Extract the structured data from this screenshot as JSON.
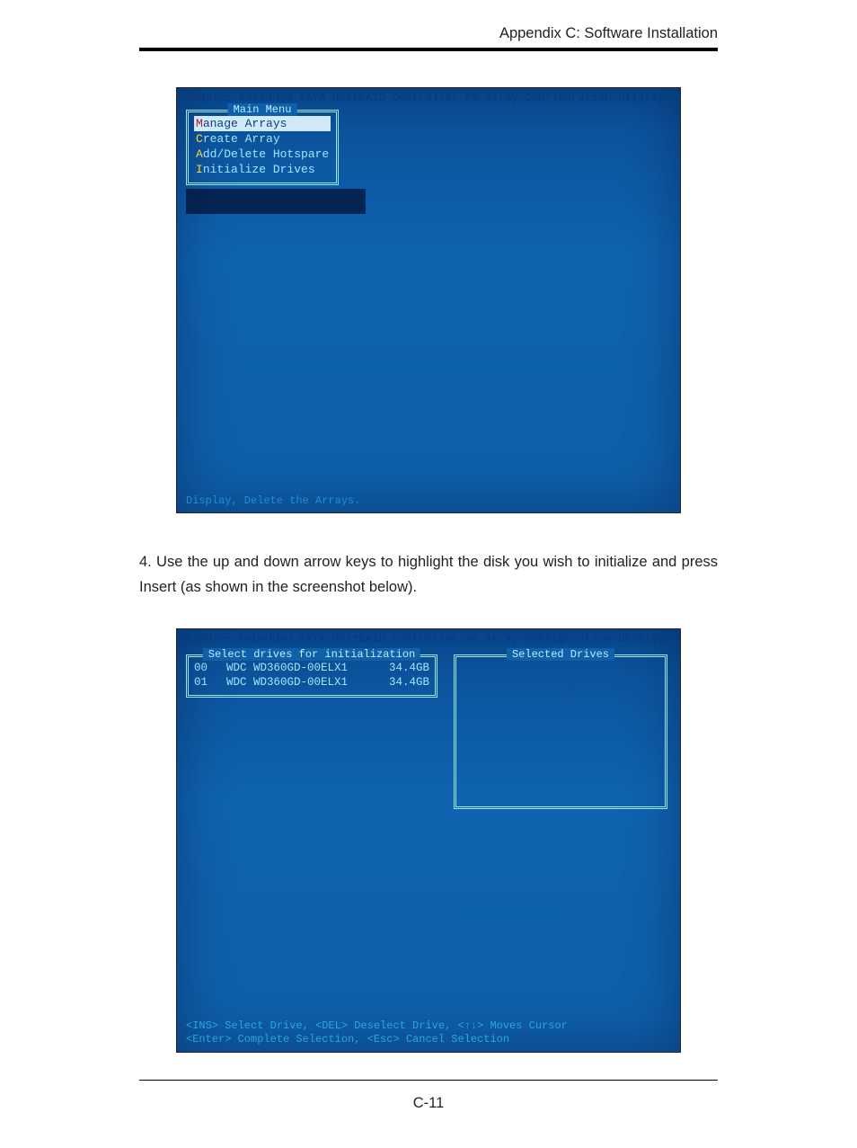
{
  "header": {
    "running": "Appendix C: Software Installation"
  },
  "footer": {
    "page": "C-11"
  },
  "paragraph": "4. Use the up and down arrow keys to highlight the disk you wish to initialize and press Insert (as shown in the screenshot below).",
  "screenshot1": {
    "title": "Adaptec Embedded SATA HostRAID Controller #0 Array Configuration Utility",
    "menu_title": "Main Menu",
    "items": [
      {
        "hotkey": "M",
        "rest": "anage Arrays",
        "selected": true
      },
      {
        "hotkey": "C",
        "rest": "reate Array",
        "selected": false
      },
      {
        "hotkey": "A",
        "rest": "dd/Delete Hotspare",
        "selected": false
      },
      {
        "hotkey": "I",
        "rest": "nitialize Drives",
        "selected": false
      }
    ],
    "footer": "Display, Delete the Arrays."
  },
  "screenshot2": {
    "title": "Adaptec Embedded SATA HostRAID Controller #0 Array Configuration Utility",
    "left_title": "Select drives for initialization",
    "right_title": "Selected Drives",
    "drives": [
      {
        "id": "00",
        "model": "WDC WD360GD-00ELX1",
        "size": "34.4GB"
      },
      {
        "id": "01",
        "model": "WDC WD360GD-00ELX1",
        "size": "34.4GB"
      }
    ],
    "hint1": "<INS> Select Drive, <DEL> Deselect Drive, <↑↓> Moves Cursor",
    "hint2": "<Enter> Complete Selection, <Esc> Cancel Selection"
  }
}
